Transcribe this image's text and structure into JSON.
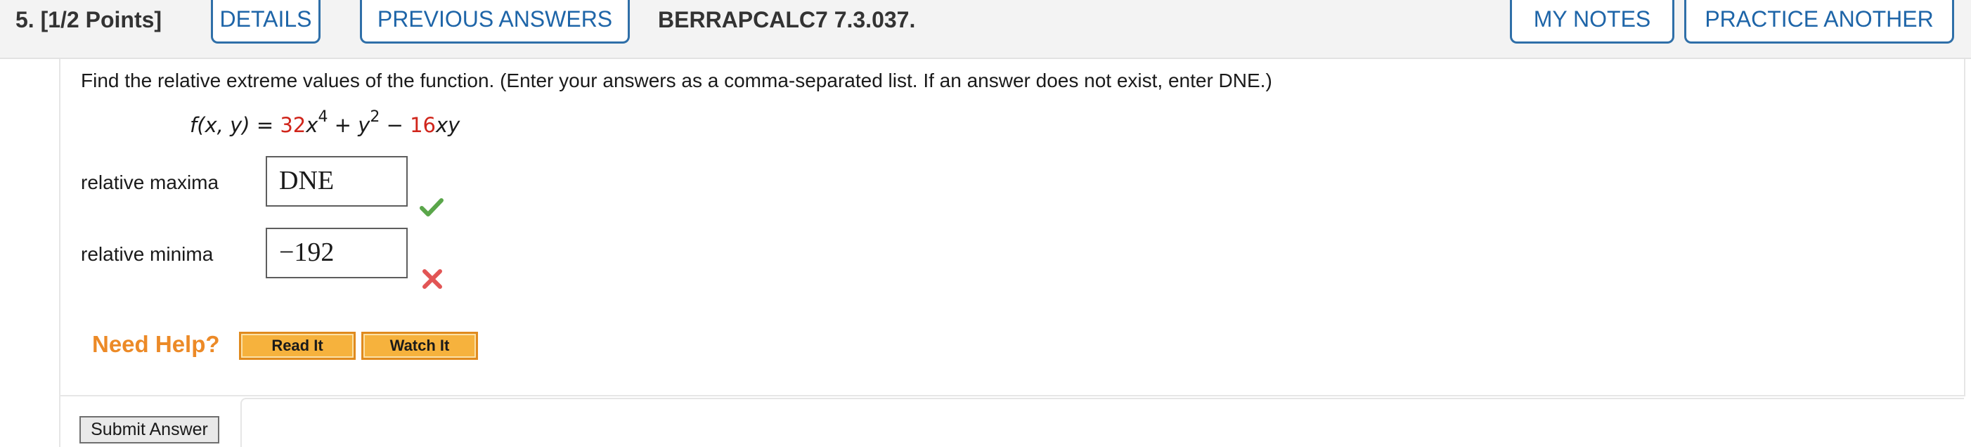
{
  "header": {
    "question_label": "5.  [1/2 Points]",
    "details_label": "DETAILS",
    "previous_answers_label": "PREVIOUS ANSWERS",
    "problem_id": "BERRAPCALC7 7.3.037.",
    "my_notes_label": "MY NOTES",
    "practice_another_label": "PRACTICE ANOTHER"
  },
  "question": {
    "instructions": "Find the relative extreme values of the function. (Enter your answers as a comma-separated list. If an answer does not exist, enter DNE.)",
    "formula": {
      "lhs": "f(x, y)",
      "equals": " = ",
      "coef1": "32",
      "term1_var": "x",
      "term1_exp": "4",
      "plus": " + ",
      "term2_var": "y",
      "term2_exp": "2",
      "minus": " − ",
      "coef3": "16",
      "term3_var": "xy"
    },
    "rows": [
      {
        "label": "relative maxima",
        "value": "DNE",
        "status": "correct",
        "mark_icon": "checkmark-icon"
      },
      {
        "label": "relative minima",
        "value": "−192",
        "status": "incorrect",
        "mark_icon": "cross-icon"
      }
    ]
  },
  "help": {
    "need_help_label": "Need Help?",
    "read_it_label": "Read It",
    "watch_it_label": "Watch It"
  },
  "submit": {
    "label": "Submit Answer"
  },
  "colors": {
    "tab_border": "#2f6fa8",
    "tab_text": "#1e65a8",
    "highlight_red": "#d0251b",
    "correct_green": "#5aa64a",
    "incorrect_red": "#e25555",
    "help_orange": "#ec8a27",
    "help_button": "#f6b23d"
  }
}
